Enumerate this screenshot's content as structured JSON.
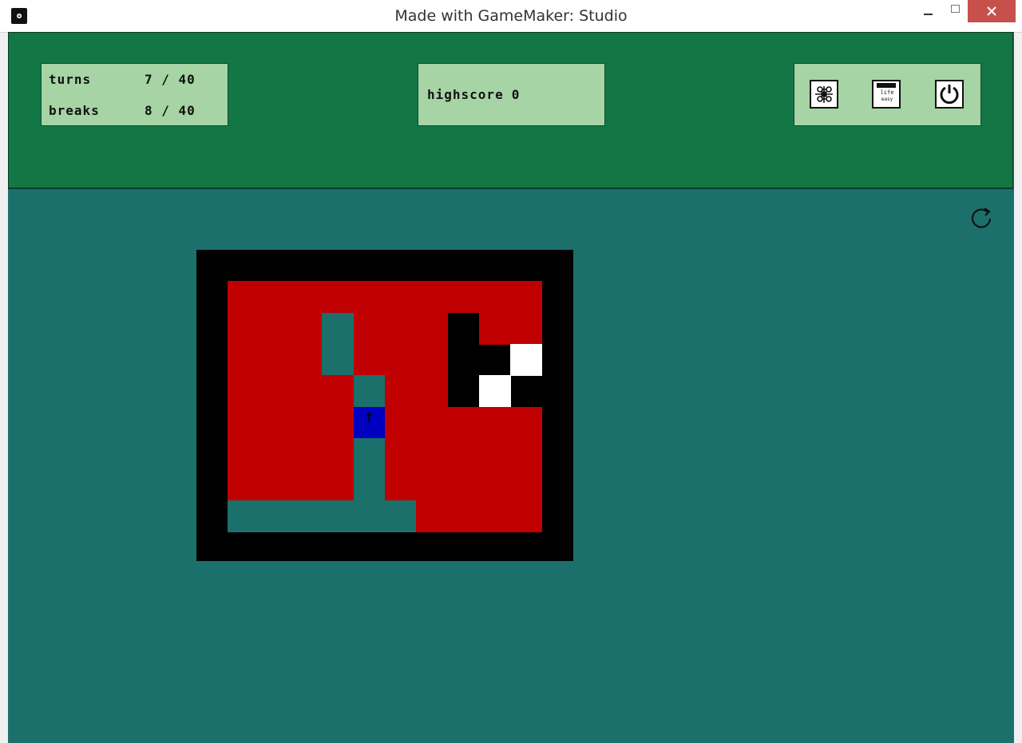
{
  "window": {
    "title": "Made with GameMaker: Studio",
    "controls": [
      "minimize",
      "maximize",
      "close"
    ]
  },
  "hud": {
    "turns_label": "turns",
    "turns_value": "7 / 40",
    "breaks_label": "breaks",
    "breaks_value": "8 / 40",
    "highscore_label": "highscore",
    "highscore_value": "0",
    "buttons": [
      {
        "name": "network-icon"
      },
      {
        "name": "mode-card",
        "top_text": "life",
        "bottom_text": "easy"
      },
      {
        "name": "power-icon"
      }
    ]
  },
  "colors": {
    "hud_bg": "#127745",
    "game_bg": "#1b706c",
    "panel_bg": "#a6d4a5",
    "wall": "#000000",
    "red_block": "#c00000",
    "teal_path": "#1b706c",
    "player": "#0000c0",
    "white": "#ffffff"
  },
  "board": {
    "cols": 12,
    "rows": 10,
    "legend": {
      "K": "wall",
      "R": "breakable",
      "T": "open",
      "P": "player",
      "W": "goal-white"
    },
    "player_direction": "up",
    "grid": [
      "KKKKKKKKKKKK",
      "KRRRRRRRRRRK",
      "KRRRTRRRKRRK",
      "KRRRTRRRKKWK",
      "KRRRRTRRKWKK",
      "KRRRRPRRRRRK",
      "KRRRRTRRRRRK",
      "KRRRRTRRRRRK",
      "KTTTTTTRRRRK",
      "KKKKKKKKKKKK"
    ]
  }
}
